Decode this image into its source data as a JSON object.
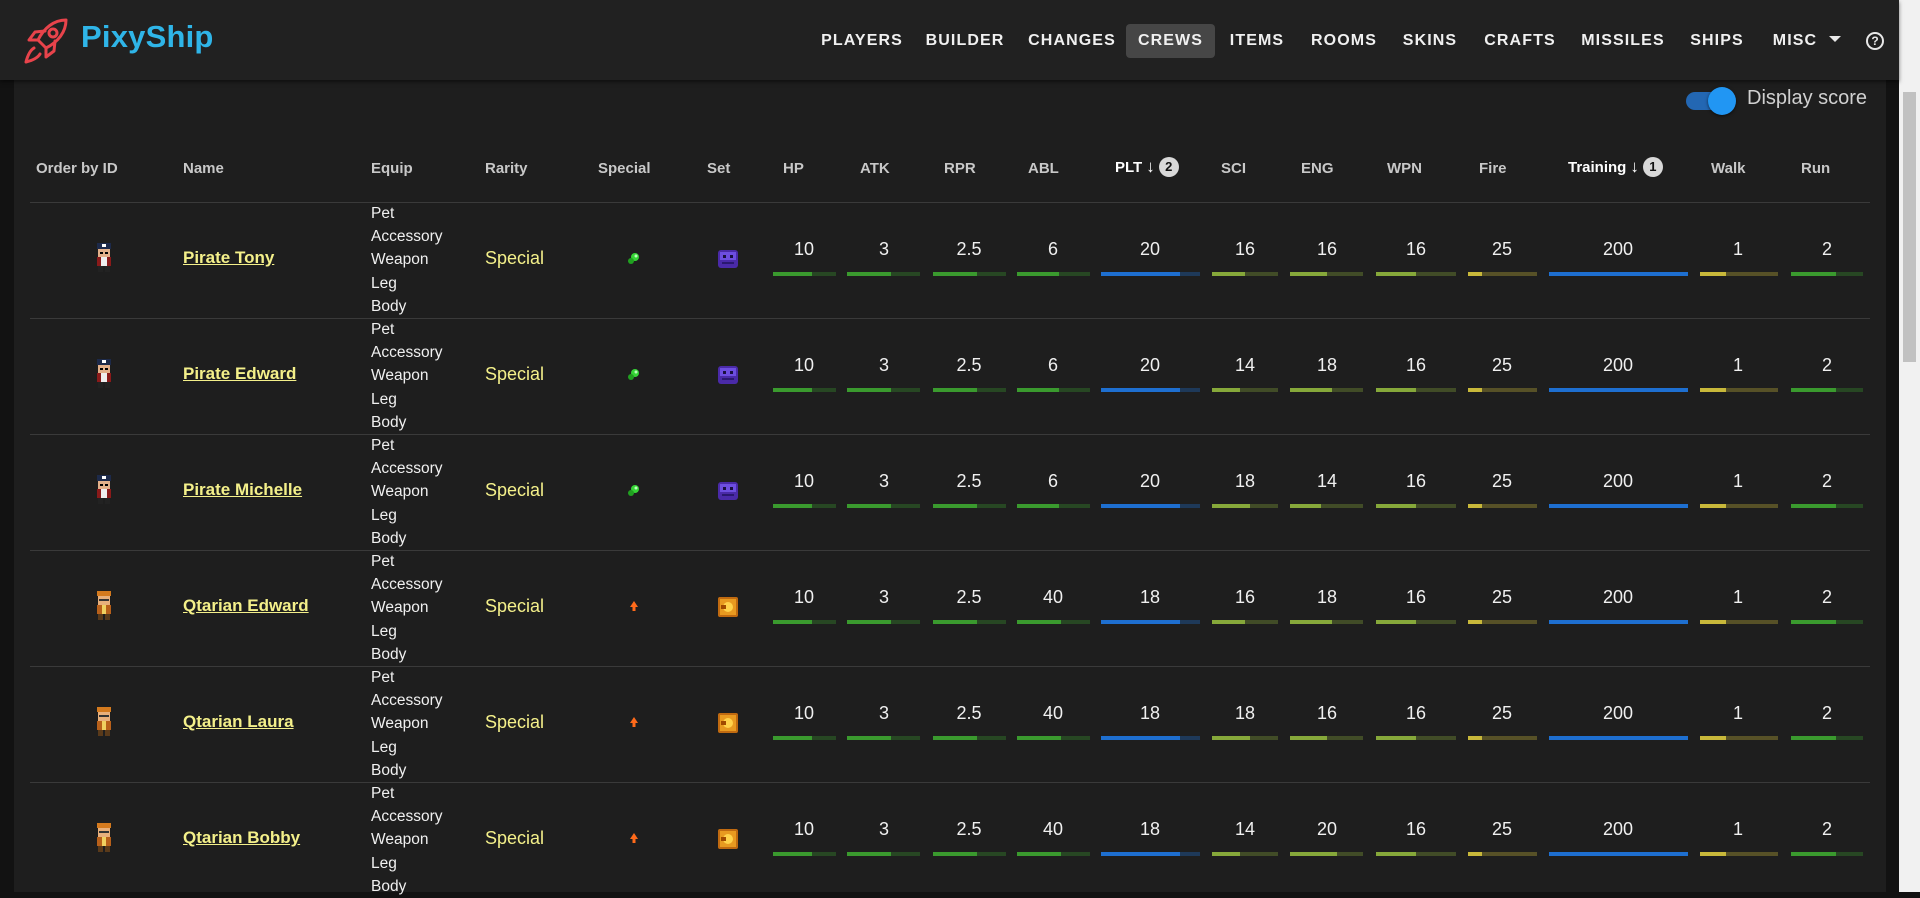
{
  "app": {
    "brand": "PixyShip"
  },
  "nav": {
    "items": [
      "PLAYERS",
      "BUILDER",
      "CHANGES",
      "CREWS",
      "ITEMS",
      "ROOMS",
      "SKINS",
      "CRAFTS",
      "MISSILES",
      "SHIPS",
      "MISC"
    ],
    "active": "CREWS"
  },
  "icons": {
    "logo": "rocket-icon",
    "help": "help-circle-icon",
    "misc": "chevron-down-icon"
  },
  "controls": {
    "display_score_label": "Display score",
    "display_score_on": true,
    "help_glyph": "?"
  },
  "colors": {
    "accent": "#2196f3",
    "link": "#f4f08a",
    "bar_green": "#3a9a2e",
    "bar_yellowgreen": "#86a83a",
    "bar_yellow": "#c8b83a",
    "bar_blue": "#1e6fd0"
  },
  "table": {
    "headers": {
      "id": "Order by ID",
      "name": "Name",
      "equip": "Equip",
      "rarity": "Rarity",
      "special": "Special",
      "set": "Set",
      "hp": "HP",
      "atk": "ATK",
      "rpr": "RPR",
      "abl": "ABL",
      "plt": "PLT",
      "sci": "SCI",
      "eng": "ENG",
      "wpn": "WPN",
      "fire": "Fire",
      "training": "Training",
      "walk": "Walk",
      "run": "Run"
    },
    "sort": {
      "plt": "2",
      "training": "1"
    },
    "rows": [
      {
        "name": "Pirate Tony",
        "equip": [
          "Pet",
          "Accessory",
          "Weapon",
          "Leg",
          "Body"
        ],
        "rarity": "Special",
        "special": "green-orb-icon",
        "set": "purple-box-icon",
        "hp": "10",
        "atk": "3",
        "rpr": "2.5",
        "abl": "6",
        "plt": "20",
        "sci": "16",
        "eng": "16",
        "wpn": "16",
        "fire": "25",
        "training": "200",
        "walk": "1",
        "run": "2"
      },
      {
        "name": "Pirate Edward",
        "equip": [
          "Pet",
          "Accessory",
          "Weapon",
          "Leg",
          "Body"
        ],
        "rarity": "Special",
        "special": "green-orb-icon",
        "set": "purple-box-icon",
        "hp": "10",
        "atk": "3",
        "rpr": "2.5",
        "abl": "6",
        "plt": "20",
        "sci": "14",
        "eng": "18",
        "wpn": "16",
        "fire": "25",
        "training": "200",
        "walk": "1",
        "run": "2"
      },
      {
        "name": "Pirate Michelle",
        "equip": [
          "Pet",
          "Accessory",
          "Weapon",
          "Leg",
          "Body"
        ],
        "rarity": "Special",
        "special": "green-orb-icon",
        "set": "purple-box-icon",
        "hp": "10",
        "atk": "3",
        "rpr": "2.5",
        "abl": "6",
        "plt": "20",
        "sci": "18",
        "eng": "14",
        "wpn": "16",
        "fire": "25",
        "training": "200",
        "walk": "1",
        "run": "2"
      },
      {
        "name": "Qtarian Edward",
        "equip": [
          "Pet",
          "Accessory",
          "Weapon",
          "Leg",
          "Body"
        ],
        "rarity": "Special",
        "special": "orange-arrow-icon",
        "set": "orange-box-icon",
        "hp": "10",
        "atk": "3",
        "rpr": "2.5",
        "abl": "40",
        "plt": "18",
        "sci": "16",
        "eng": "18",
        "wpn": "16",
        "fire": "25",
        "training": "200",
        "walk": "1",
        "run": "2"
      },
      {
        "name": "Qtarian Laura",
        "equip": [
          "Pet",
          "Accessory",
          "Weapon",
          "Leg",
          "Body"
        ],
        "rarity": "Special",
        "special": "orange-arrow-icon",
        "set": "orange-box-icon",
        "hp": "10",
        "atk": "3",
        "rpr": "2.5",
        "abl": "40",
        "plt": "18",
        "sci": "18",
        "eng": "16",
        "wpn": "16",
        "fire": "25",
        "training": "200",
        "walk": "1",
        "run": "2"
      },
      {
        "name": "Qtarian Bobby",
        "equip": [
          "Pet",
          "Accessory",
          "Weapon",
          "Leg",
          "Body"
        ],
        "rarity": "Special",
        "special": "orange-arrow-icon",
        "set": "orange-box-icon",
        "hp": "10",
        "atk": "3",
        "rpr": "2.5",
        "abl": "40",
        "plt": "18",
        "sci": "14",
        "eng": "20",
        "wpn": "16",
        "fire": "25",
        "training": "200",
        "walk": "1",
        "run": "2"
      }
    ]
  }
}
